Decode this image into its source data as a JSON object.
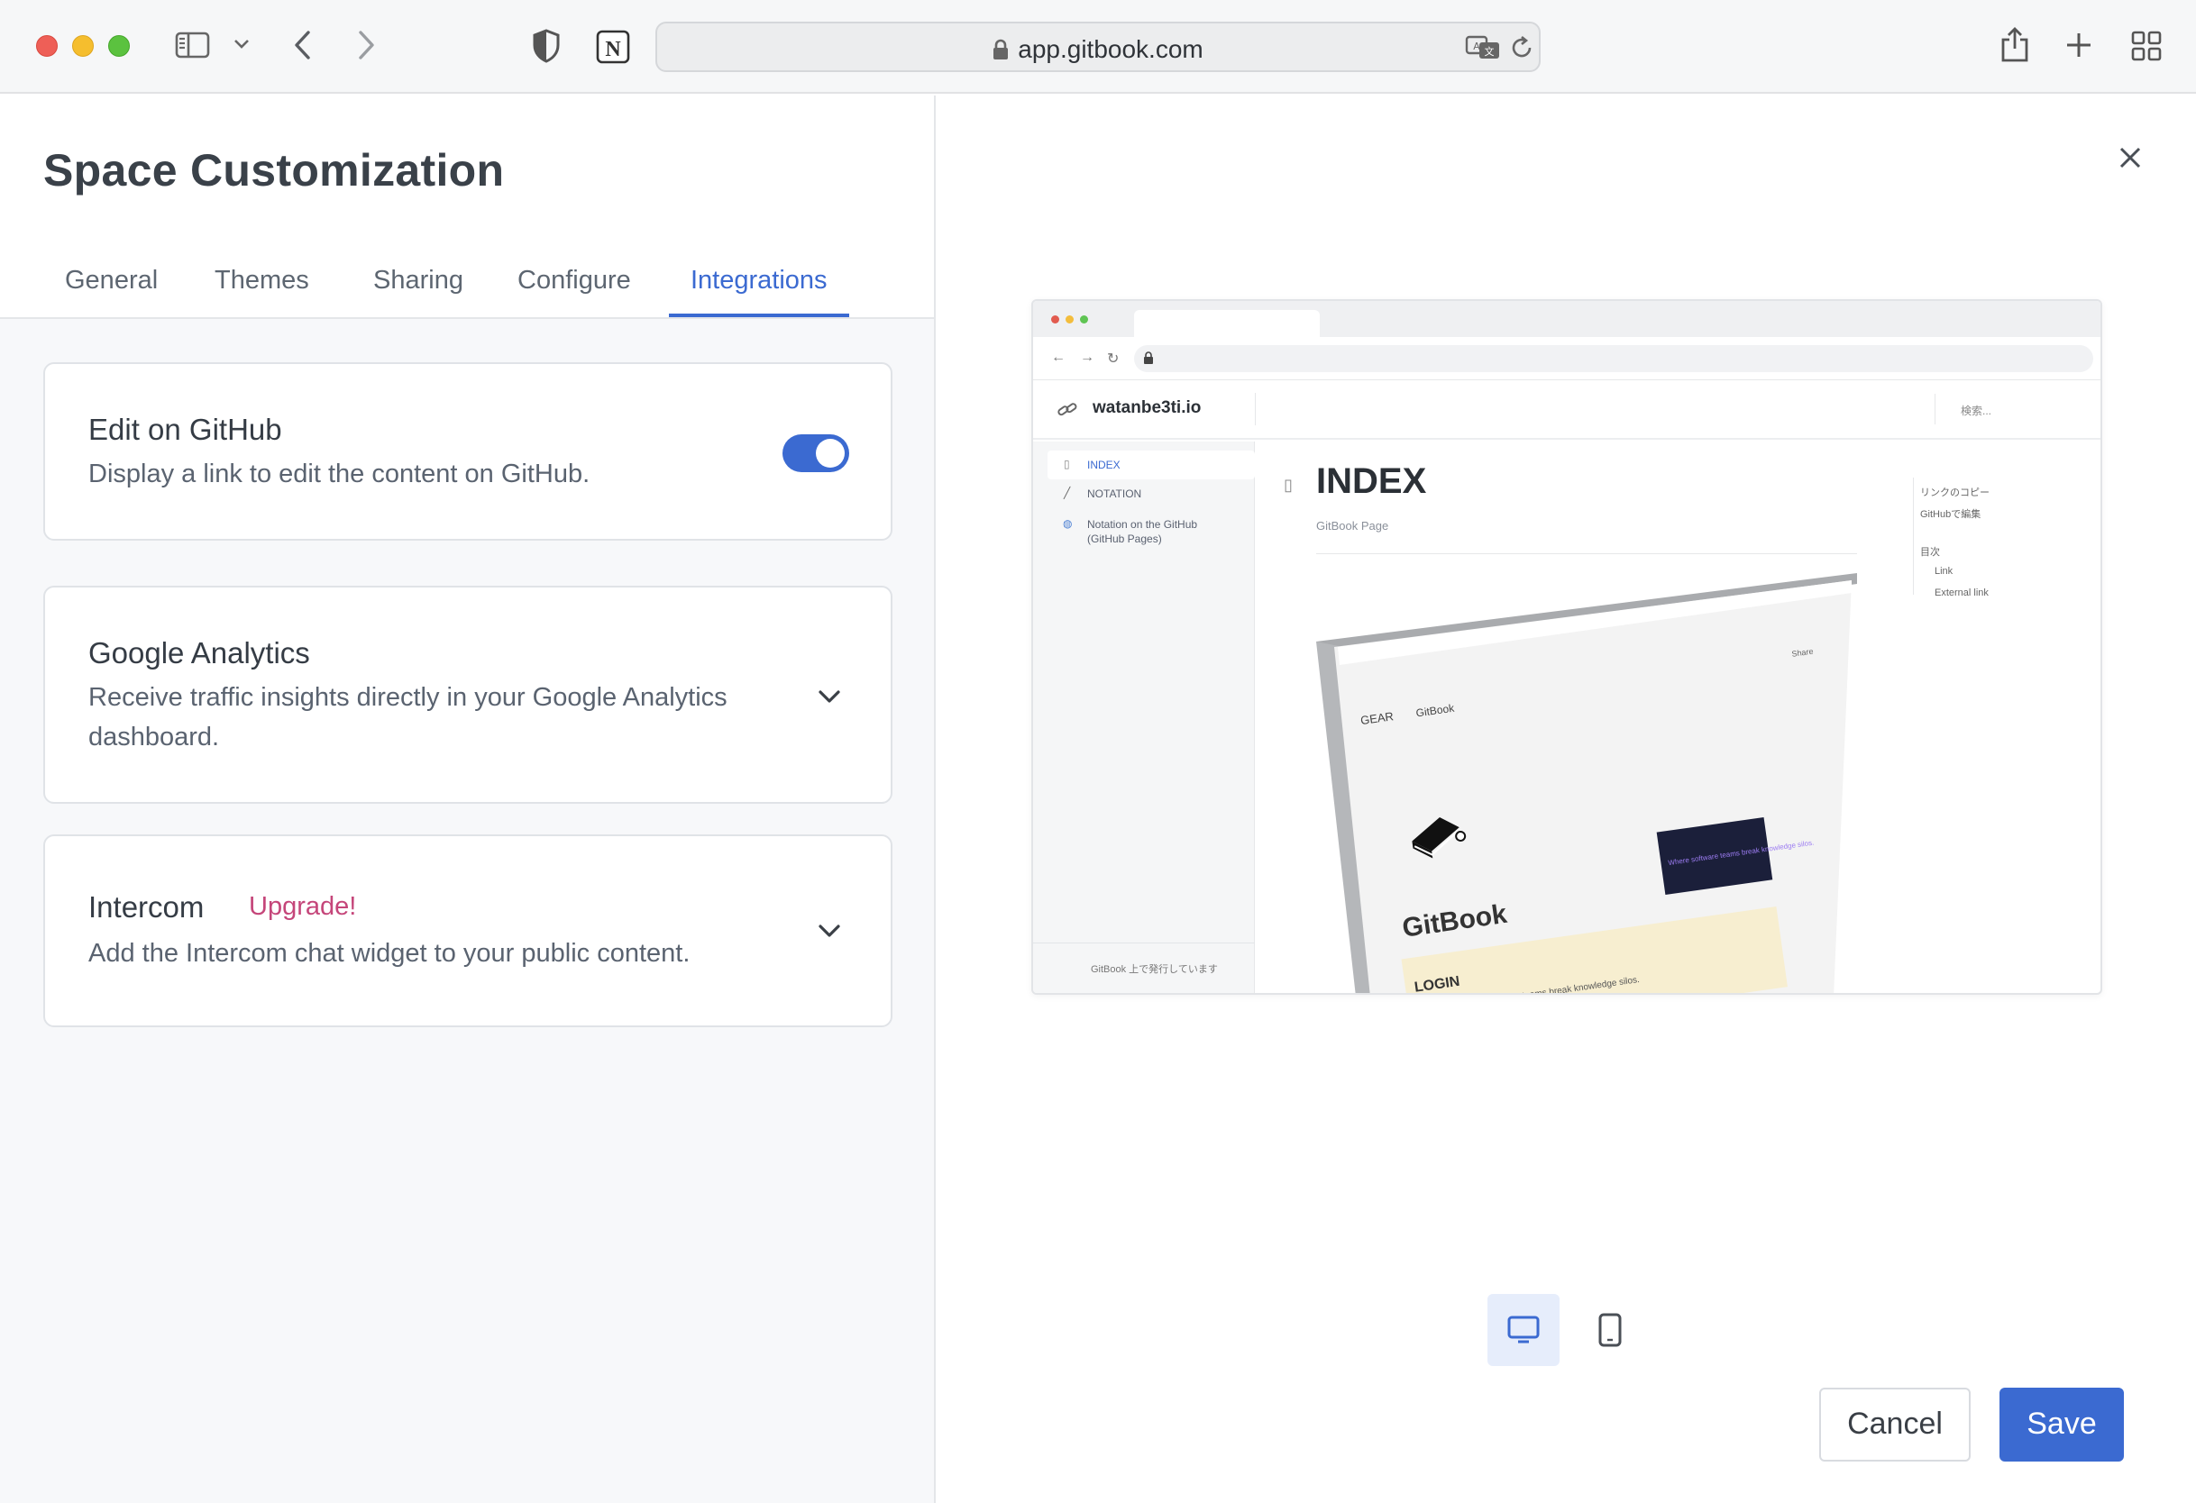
{
  "browser": {
    "url": "app.gitbook.com",
    "icons": [
      "sidebar-icon",
      "chevron-down-icon",
      "back-icon",
      "forward-icon",
      "shield-icon",
      "notion-icon",
      "lock-icon",
      "translate-icon",
      "reload-icon",
      "share-icon",
      "new-tab-icon",
      "tab-overview-icon"
    ]
  },
  "panel": {
    "title": "Space Customization",
    "tabs": [
      {
        "label": "General",
        "active": false
      },
      {
        "label": "Themes",
        "active": false
      },
      {
        "label": "Sharing",
        "active": false
      },
      {
        "label": "Configure",
        "active": false
      },
      {
        "label": "Integrations",
        "active": true
      }
    ]
  },
  "integrations": [
    {
      "title": "Edit on GitHub",
      "description": "Display a link to edit the content on GitHub.",
      "control": "toggle",
      "enabled": true
    },
    {
      "title": "Google Analytics",
      "description": "Receive traffic insights directly in your Google Analytics dashboard.",
      "control": "chevron-down-icon"
    },
    {
      "title": "Intercom",
      "badge": "Upgrade!",
      "description": "Add the Intercom chat widget to your public content.",
      "control": "chevron-down-icon"
    }
  ],
  "preview": {
    "site_name": "watanbe3ti.io",
    "search_placeholder": "検索...",
    "sidebar": [
      "INDEX",
      "NOTATION",
      "Notation on the GitHub",
      "(GitHub Pages)"
    ],
    "footer": "GitBook 上で発行しています",
    "heading": "INDEX",
    "subheading": "GitBook Page",
    "toc": [
      "リンクのコピー",
      "GitHubで編集",
      "目次",
      "Link",
      "External link"
    ],
    "image": {
      "breadcrumb_1": "GEAR",
      "breadcrumb_2": "GitBook",
      "share": "Share",
      "brand": "GitBook",
      "login": "LOGIN",
      "tagline": "GitBook - Where software teams break knowledge silos.",
      "banner": "Where software teams break knowledge silos."
    }
  },
  "view_modes": [
    {
      "icon": "desktop-icon",
      "active": true
    },
    {
      "icon": "tablet-icon",
      "active": false
    }
  ],
  "actions": {
    "cancel": "Cancel",
    "save": "Save"
  },
  "colors": {
    "accent": "#3b6ad1",
    "upgrade": "#c5467a",
    "panel_bg": "#f7f8fa"
  }
}
